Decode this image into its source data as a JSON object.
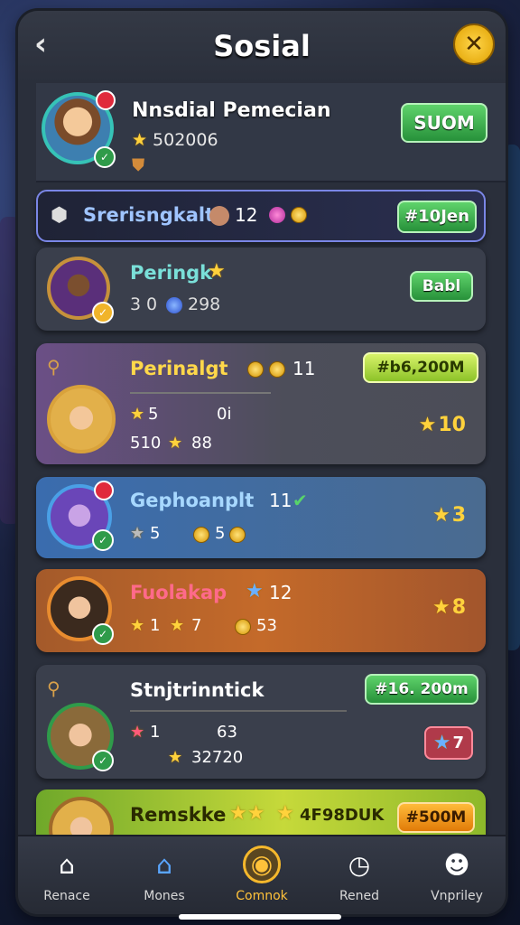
{
  "header": {
    "title": "Sosial",
    "back_icon": "chevron-left-icon",
    "close_icon": "close-icon"
  },
  "profile": {
    "name": "Nnsdial Pemecian",
    "score": "502006",
    "button": "SUOM"
  },
  "highlight": {
    "name": "Srerisngkalt",
    "value": "12",
    "button": "#10Jen"
  },
  "rows": [
    {
      "name": "Peringk",
      "s1": "3",
      "s2": "0",
      "s3": "298",
      "button": "Babl"
    },
    {
      "name": "Perinalgt",
      "level": "11",
      "a1": "5",
      "a2": "0i",
      "b1": "510",
      "b2": "88",
      "button": "#b6,200M",
      "rank": "10"
    },
    {
      "name": "Gephoanplt",
      "level": "11",
      "a1": "5",
      "a2": "5",
      "rank": "3"
    },
    {
      "name": "Fuolakap",
      "level": "12",
      "a1": "1",
      "a2": "7",
      "a3": "53",
      "rank": "8"
    },
    {
      "name": "Stnjtrinntick",
      "a1": "1",
      "a2": "63",
      "b1": "32720",
      "button": "#16. 200m",
      "rank": "7"
    },
    {
      "name": "Remskke",
      "extra": "4F98DUK",
      "button": "#500M"
    }
  ],
  "tabs": [
    {
      "label": "Renace",
      "icon": "home-icon"
    },
    {
      "label": "Mones",
      "icon": "house-icon"
    },
    {
      "label": "Comnok",
      "icon": "coin-icon"
    },
    {
      "label": "Rened",
      "icon": "clock-icon"
    },
    {
      "label": "Vnpriley",
      "icon": "profile-icon"
    }
  ],
  "colors": {
    "accent": "#f5b82c",
    "green": "#27913a",
    "panel": "#2a2f3b"
  }
}
